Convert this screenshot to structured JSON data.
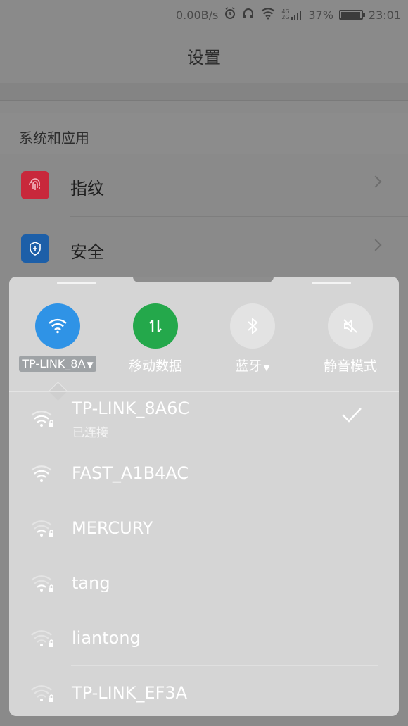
{
  "status_bar": {
    "net_speed": "0.00B/s",
    "network_type": "4G 2G",
    "battery": "37%",
    "time": "23:01",
    "icons": [
      "alarm-icon",
      "headphones-icon",
      "wifi-icon",
      "signal-icon",
      "battery-icon"
    ]
  },
  "settings": {
    "title": "设置",
    "section_header": "系统和应用",
    "rows": [
      {
        "label": "指纹",
        "icon": "fingerprint-icon",
        "color": "#c8283b"
      },
      {
        "label": "安全",
        "icon": "shield-icon",
        "color": "#1d5fa8"
      }
    ]
  },
  "quick_panel": {
    "toggles": [
      {
        "label": "TP-LINK_8A",
        "icon": "wifi-icon",
        "active": true,
        "color": "#2f93e6",
        "has_dropdown": true
      },
      {
        "label": "移动数据",
        "icon": "mobile-data-icon",
        "active": true,
        "color": "#24a84b",
        "has_dropdown": false
      },
      {
        "label": "蓝牙",
        "icon": "bluetooth-icon",
        "active": false,
        "color": "#e6e6e6",
        "has_dropdown": true
      },
      {
        "label": "静音模式",
        "icon": "mute-icon",
        "active": false,
        "color": "#e6e6e6",
        "has_dropdown": false
      }
    ],
    "wifi_networks": [
      {
        "ssid": "TP-LINK_8A6C",
        "status": "已连接",
        "locked": true,
        "connected": true
      },
      {
        "ssid": "FAST_A1B4AC",
        "status": "",
        "locked": false,
        "connected": false
      },
      {
        "ssid": "MERCURY",
        "status": "",
        "locked": true,
        "connected": false
      },
      {
        "ssid": "tang",
        "status": "",
        "locked": true,
        "connected": false
      },
      {
        "ssid": "liantong",
        "status": "",
        "locked": true,
        "connected": false
      },
      {
        "ssid": "TP-LINK_EF3A",
        "status": "",
        "locked": true,
        "connected": false
      }
    ]
  }
}
